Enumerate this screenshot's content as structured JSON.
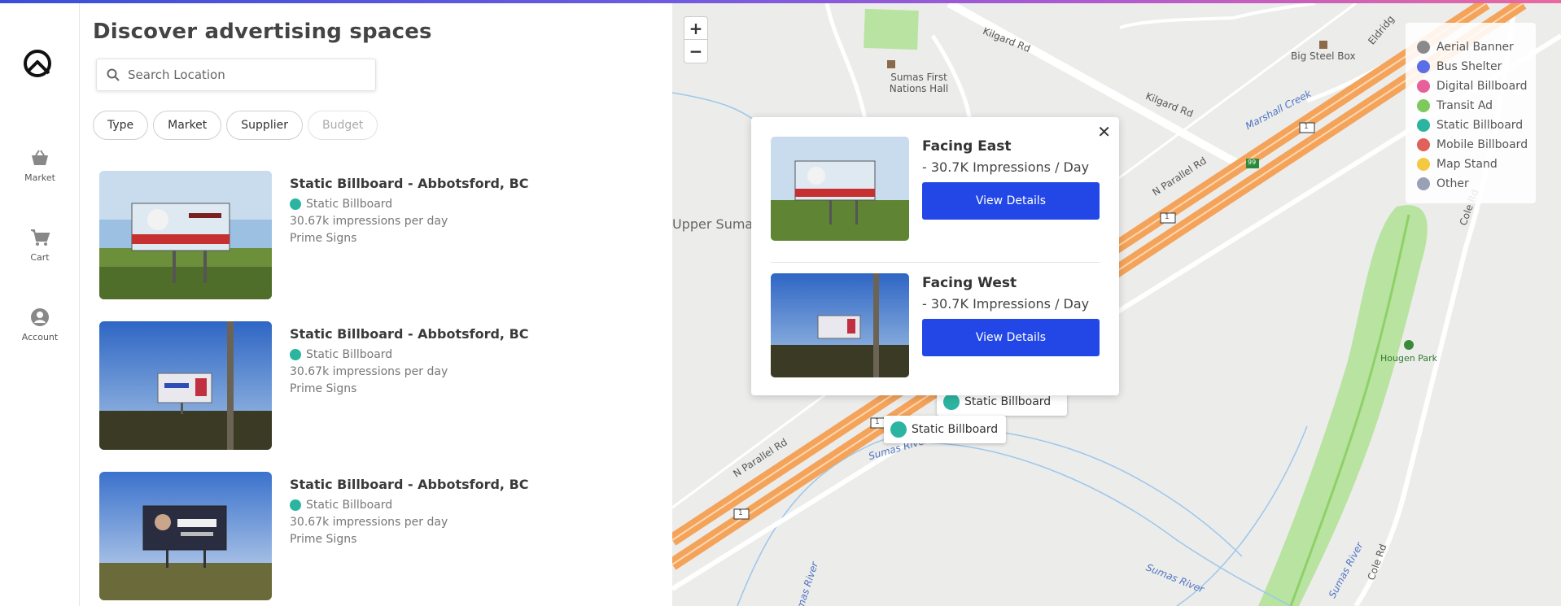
{
  "app": {
    "nav": [
      {
        "label": "Market",
        "icon": "basket-icon"
      },
      {
        "label": "Cart",
        "icon": "cart-icon"
      },
      {
        "label": "Account",
        "icon": "account-icon"
      }
    ]
  },
  "list": {
    "title": "Discover advertising spaces",
    "search_placeholder": "Search Location",
    "filters": [
      "Type",
      "Market",
      "Supplier",
      "Budget"
    ],
    "items": [
      {
        "title": "Static Billboard - Abbotsford, BC",
        "type": "Static Billboard",
        "impressions": "30.67k impressions per day",
        "supplier": "Prime Signs"
      },
      {
        "title": "Static Billboard - Abbotsford, BC",
        "type": "Static Billboard",
        "impressions": "30.67k impressions per day",
        "supplier": "Prime Signs"
      },
      {
        "title": "Static Billboard - Abbotsford, BC",
        "type": "Static Billboard",
        "impressions": "30.67k impressions per day",
        "supplier": "Prime Signs"
      }
    ]
  },
  "map": {
    "zoom_in": "+",
    "zoom_out": "−",
    "labels": {
      "kilgard1": "Kilgard Rd",
      "kilgard2": "Kilgard Rd",
      "hall": "Sumas First Nations Hall",
      "steel": "Big Steel Box",
      "marshall": "Marshall Creek",
      "nparallel1": "N Parallel Rd",
      "nparallel2": "N Parallel Rd",
      "upper": "Upper Sumas",
      "hougen": "Hougen Park",
      "sumas1": "Sumas River",
      "sumas2": "Sumas River",
      "sumas3": "Sumas River",
      "sumas4": "Sumas River",
      "cole1": "Cole Rd",
      "cole2": "Cole Rd",
      "eldridge": "Eldridg",
      "shield1": "1",
      "shield2": "1",
      "shield3": "1",
      "shield4": "1",
      "shield99": "99"
    },
    "legend": [
      {
        "label": "Aerial Banner",
        "color": "#8a8a8a"
      },
      {
        "label": "Bus Shelter",
        "color": "#5a6ee8"
      },
      {
        "label": "Digital Billboard",
        "color": "#e8609a"
      },
      {
        "label": "Transit Ad",
        "color": "#7dc95e"
      },
      {
        "label": "Static Billboard",
        "color": "#2bb5a0"
      },
      {
        "label": "Mobile Billboard",
        "color": "#e0605a"
      },
      {
        "label": "Map Stand",
        "color": "#f5c842"
      },
      {
        "label": "Other",
        "color": "#9aa0b5"
      }
    ],
    "popup": {
      "items": [
        {
          "title": "Facing East",
          "sub": "- 30.7K Impressions / Day",
          "button": "View Details"
        },
        {
          "title": "Facing West",
          "sub": "- 30.7K Impressions / Day",
          "button": "View Details"
        }
      ]
    },
    "markers": [
      {
        "label": "Static Billboard"
      },
      {
        "label": "Static Billboard"
      }
    ]
  }
}
